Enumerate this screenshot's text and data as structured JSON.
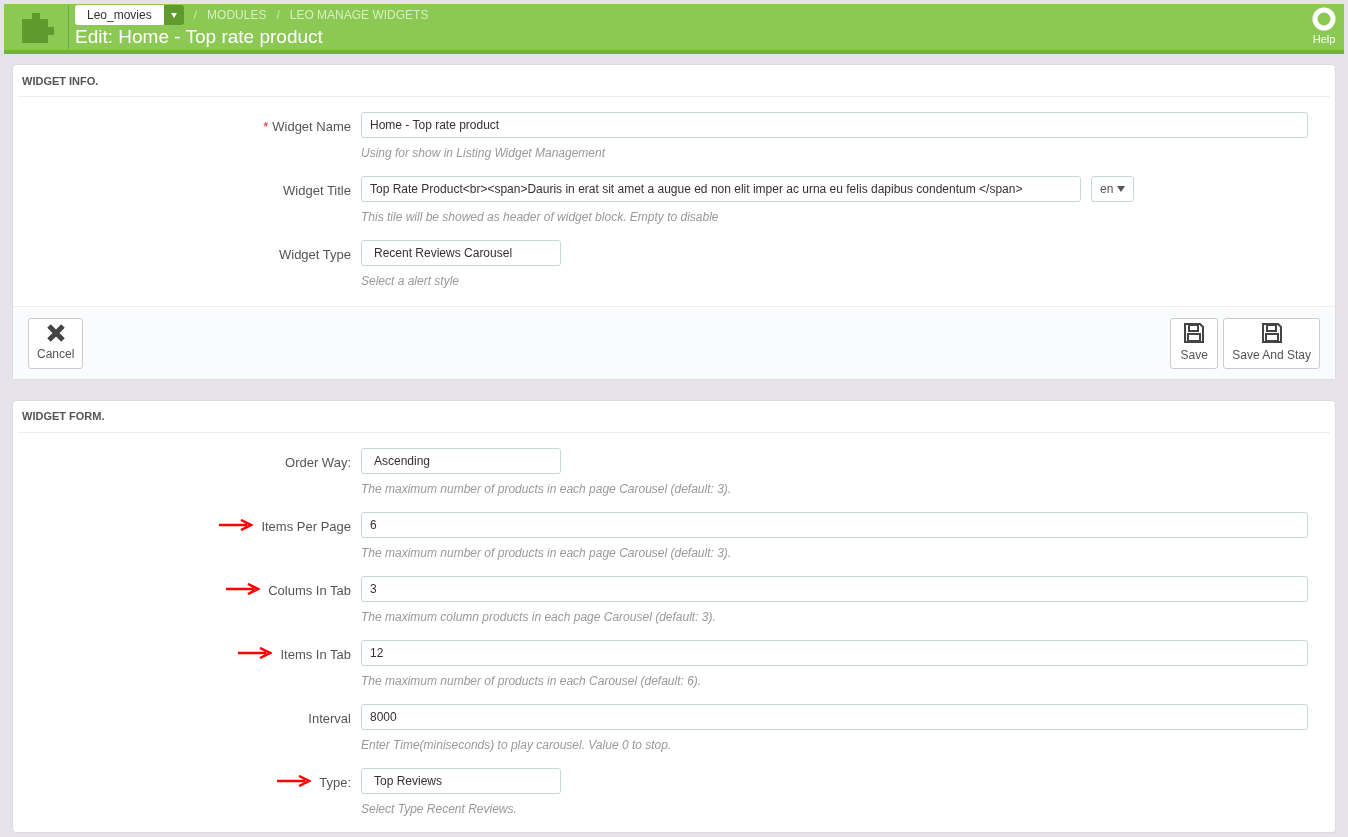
{
  "header": {
    "shop": "Leo_movies",
    "breadcrumbs": [
      {
        "separator": "/",
        "label": "MODULES"
      },
      {
        "separator": "/",
        "label": "LEO MANAGE WIDGETS"
      }
    ],
    "title": "Edit: Home - Top rate product",
    "help": "Help"
  },
  "info_panel": {
    "heading": "WIDGET INFO.",
    "fields": [
      {
        "kind": "text",
        "label": "Widget Name",
        "required_mark": "*",
        "marked": false,
        "value": "Home - Top rate product",
        "help": "Using for show in Listing Widget Management"
      },
      {
        "kind": "translatable",
        "label": "Widget Title",
        "marked": false,
        "value": "Top Rate Product<br><span>Dauris in erat sit amet a augue ed non elit imper ac urna eu felis dapibus condentum </span>",
        "lang": "en",
        "help": "This tile will be showed as header of widget block. Empty to disable"
      },
      {
        "kind": "select",
        "label": "Widget Type",
        "marked": false,
        "value": "Recent Reviews Carousel",
        "help": "Select a alert style"
      }
    ],
    "buttons": [
      {
        "kind": "cancel",
        "label": "Cancel"
      },
      {
        "kind": "save",
        "label": "Save"
      },
      {
        "kind": "save",
        "label": "Save And Stay"
      }
    ]
  },
  "form_panel": {
    "heading": "WIDGET FORM.",
    "fields": [
      {
        "kind": "select",
        "label": "Order Way:",
        "marked": false,
        "value": "Ascending",
        "help": "The maximum number of products in each page Carousel (default: 3)."
      },
      {
        "kind": "text",
        "label": "Items Per Page",
        "marked": true,
        "value": "6",
        "help": "The maximum number of products in each page Carousel (default: 3)."
      },
      {
        "kind": "text",
        "label": "Colums In Tab",
        "marked": true,
        "value": "3",
        "help": "The maximum column products in each page Carousel (default: 3)."
      },
      {
        "kind": "text",
        "label": "Items In Tab",
        "marked": true,
        "value": "12",
        "help": "The maximum number of products in each Carousel (default: 6)."
      },
      {
        "kind": "text",
        "label": "Interval",
        "marked": false,
        "value": "8000",
        "help": "Enter Time(miniseconds) to play carousel. Value 0 to stop."
      },
      {
        "kind": "select",
        "label": "Type:",
        "marked": true,
        "value": "Top Reviews",
        "help": "Select Type Recent Reviews."
      }
    ]
  }
}
